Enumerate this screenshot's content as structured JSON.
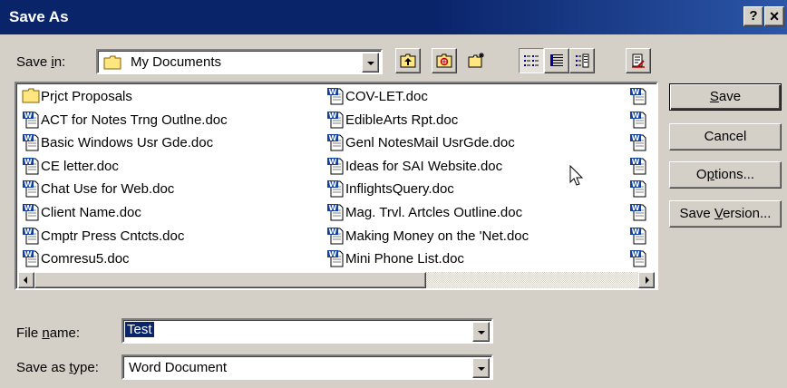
{
  "window": {
    "title": "Save As",
    "help_label": "?",
    "close_label": "×"
  },
  "save_in": {
    "label_pre": "Save ",
    "label_u": "i",
    "label_post": "n:",
    "value": "My Documents"
  },
  "toolbar": {
    "buttons": [
      {
        "name": "up-one-level-button",
        "icon": "folder-up-icon"
      },
      {
        "name": "search-web-button",
        "icon": "search-web-icon"
      },
      {
        "name": "create-new-folder-button",
        "icon": "new-folder-icon"
      },
      {
        "name": "list-view-button",
        "icon": "list-view-icon",
        "state": "pressed"
      },
      {
        "name": "details-view-button",
        "icon": "details-view-icon"
      },
      {
        "name": "properties-view-button",
        "icon": "properties-view-icon"
      },
      {
        "name": "tools-button",
        "icon": "tools-icon"
      }
    ]
  },
  "files": {
    "column1": [
      {
        "name": "Prjct Proposals",
        "type": "folder"
      },
      {
        "name": "ACT for Notes Trng Outlne.doc",
        "type": "doc"
      },
      {
        "name": "Basic Windows Usr Gde.doc",
        "type": "doc"
      },
      {
        "name": "CE letter.doc",
        "type": "doc"
      },
      {
        "name": "Chat Use for Web.doc",
        "type": "doc"
      },
      {
        "name": "Client Name.doc",
        "type": "doc"
      },
      {
        "name": "Cmptr Press Cntcts.doc",
        "type": "doc"
      },
      {
        "name": "Comresu5.doc",
        "type": "doc"
      }
    ],
    "column2": [
      {
        "name": "COV-LET.doc",
        "type": "doc"
      },
      {
        "name": "EdibleArts Rpt.doc",
        "type": "doc"
      },
      {
        "name": "Genl NotesMail UsrGde.doc",
        "type": "doc"
      },
      {
        "name": "Ideas for SAI Website.doc",
        "type": "doc"
      },
      {
        "name": "InflightsQuery.doc",
        "type": "doc"
      },
      {
        "name": "Mag. Trvl. Artcles Outline.doc",
        "type": "doc"
      },
      {
        "name": "Making Money on the 'Net.doc",
        "type": "doc"
      },
      {
        "name": "Mini Phone List.doc",
        "type": "doc"
      }
    ],
    "column3_count": 8
  },
  "buttons": {
    "save_u": "S",
    "save_rest": "ave",
    "cancel": "Cancel",
    "options_pre": "O",
    "options_u": "p",
    "options_post": "tions...",
    "version_pre": "Save ",
    "version_u": "V",
    "version_post": "ersion..."
  },
  "file_name": {
    "label_pre": "File ",
    "label_u": "n",
    "label_post": "ame:",
    "value": "Test"
  },
  "save_as_type": {
    "label_pre": "Save as ",
    "label_u": "t",
    "label_post": "ype:",
    "value": "Word Document"
  }
}
